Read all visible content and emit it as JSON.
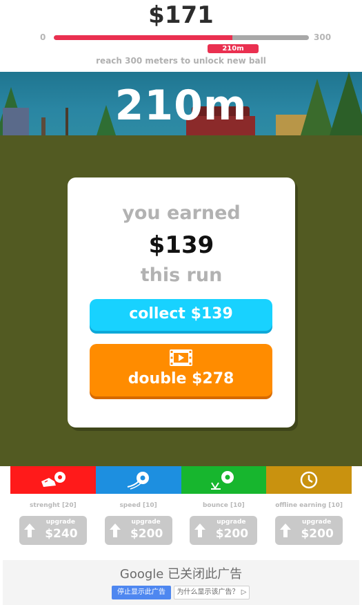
{
  "header": {
    "money": "$171",
    "progress_min": "0",
    "progress_max": "300",
    "progress_value": 210,
    "progress_marker": "210m",
    "caption": "reach 300 meters to unlock new ball"
  },
  "scene": {
    "distance": "210m"
  },
  "result_card": {
    "earned_label": "you earned",
    "amount": "$139",
    "run_label": "this run",
    "collect_label": "collect $139",
    "double_label": "double $278",
    "double_icon": "video-film-icon"
  },
  "categories": [
    {
      "name": "strenght [20]",
      "color": "#ff1a1a",
      "icon": "kick-shoe-icon"
    },
    {
      "name": "speed [10]",
      "color": "#1d8fe0",
      "icon": "speed-ball-icon"
    },
    {
      "name": "bounce [10]",
      "color": "#17b62e",
      "icon": "bounce-ball-icon"
    },
    {
      "name": "offline earning [10]",
      "color": "#c9920f",
      "icon": "clock-icon"
    }
  ],
  "upgrades": [
    {
      "label": "upgrade",
      "price": "$240"
    },
    {
      "label": "upgrade",
      "price": "$200"
    },
    {
      "label": "upgrade",
      "price": "$200"
    },
    {
      "label": "upgrade",
      "price": "$200"
    }
  ],
  "ad": {
    "title": "Google 已关闭此广告",
    "stop_label": "停止显示此广告",
    "why_label": "为什么显示该广告？ ▷"
  }
}
